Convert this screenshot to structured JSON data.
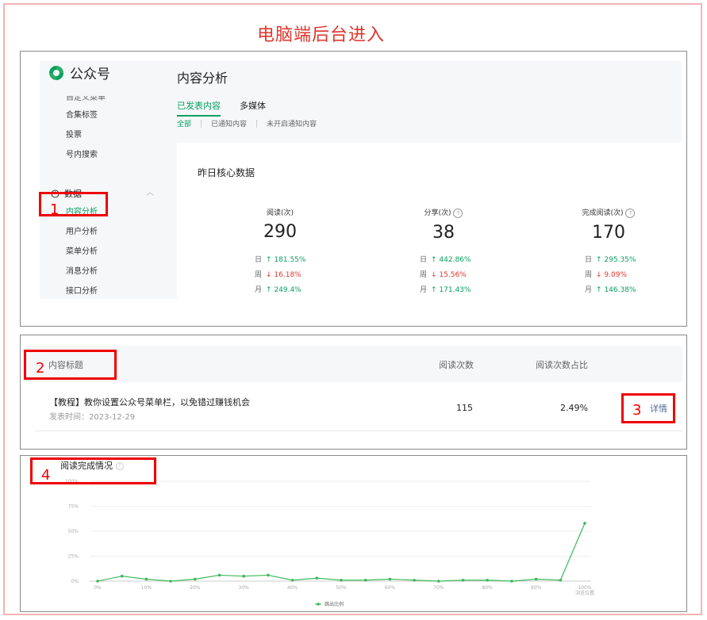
{
  "heading": "电脑端后台进入",
  "sidebar": {
    "logo_text": "公众号",
    "cut_item": "自定义菜单",
    "items_top": [
      "合集标签",
      "投票",
      "号内搜索"
    ],
    "group_label": "数据",
    "items_data": [
      "内容分析",
      "用户分析",
      "菜单分析",
      "消息分析",
      "接口分析"
    ]
  },
  "page": {
    "title": "内容分析",
    "tabs": [
      "已发表内容",
      "多媒体"
    ],
    "subtabs": [
      "全部",
      "已通知内容",
      "未开启通知内容"
    ]
  },
  "core": {
    "title": "昨日核心数据",
    "metrics": [
      {
        "label": "阅读(次)",
        "value": "290",
        "help": false,
        "rows": [
          {
            "k": "日",
            "arrow": "↑",
            "v": "181.55%",
            "dir": "up"
          },
          {
            "k": "周",
            "arrow": "↓",
            "v": "16.18%",
            "dir": "down"
          },
          {
            "k": "月",
            "arrow": "↑",
            "v": "249.4%",
            "dir": "up"
          }
        ]
      },
      {
        "label": "分享(次)",
        "value": "38",
        "help": true,
        "rows": [
          {
            "k": "日",
            "arrow": "↑",
            "v": "442.86%",
            "dir": "up"
          },
          {
            "k": "周",
            "arrow": "↓",
            "v": "15.56%",
            "dir": "down"
          },
          {
            "k": "月",
            "arrow": "↑",
            "v": "171.43%",
            "dir": "up"
          }
        ]
      },
      {
        "label": "完成阅读(次)",
        "value": "170",
        "help": true,
        "rows": [
          {
            "k": "日",
            "arrow": "↑",
            "v": "295.35%",
            "dir": "up"
          },
          {
            "k": "周",
            "arrow": "↓",
            "v": "9.09%",
            "dir": "down"
          },
          {
            "k": "月",
            "arrow": "↑",
            "v": "146.38%",
            "dir": "up"
          }
        ]
      }
    ]
  },
  "table": {
    "col_title": "内容标题",
    "col_reads": "阅读次数",
    "col_ratio": "阅读次数占比",
    "row": {
      "title": "【教程】教你设置公众号菜单栏，以免错过赚钱机会",
      "date": "发表时间：2023-12-29",
      "reads": "115",
      "ratio": "2.49%",
      "action": "详情"
    }
  },
  "markers": [
    "1",
    "2",
    "3",
    "4"
  ],
  "chart_data": {
    "type": "line",
    "title": "阅读完成情况",
    "xlabel": "浏览位置",
    "ylabel": "",
    "x": [
      0,
      5,
      10,
      15,
      20,
      25,
      30,
      35,
      40,
      45,
      50,
      55,
      60,
      65,
      70,
      75,
      80,
      85,
      90,
      95,
      100
    ],
    "x_ticks": [
      "0%",
      "10%",
      "20%",
      "30%",
      "40%",
      "50%",
      "60%",
      "70%",
      "80%",
      "90%",
      "100%"
    ],
    "y_ticks": [
      "0%",
      "25%",
      "50%",
      "75%",
      "100%"
    ],
    "ylim": [
      0,
      100
    ],
    "series": [
      {
        "name": "跳出比例",
        "color": "#3cb95a",
        "values": [
          0,
          5,
          2,
          0,
          2,
          6,
          5,
          6,
          1,
          3,
          1,
          1,
          2,
          1,
          0,
          1,
          1,
          0,
          2,
          1,
          58
        ]
      }
    ],
    "legend": "bottom"
  }
}
